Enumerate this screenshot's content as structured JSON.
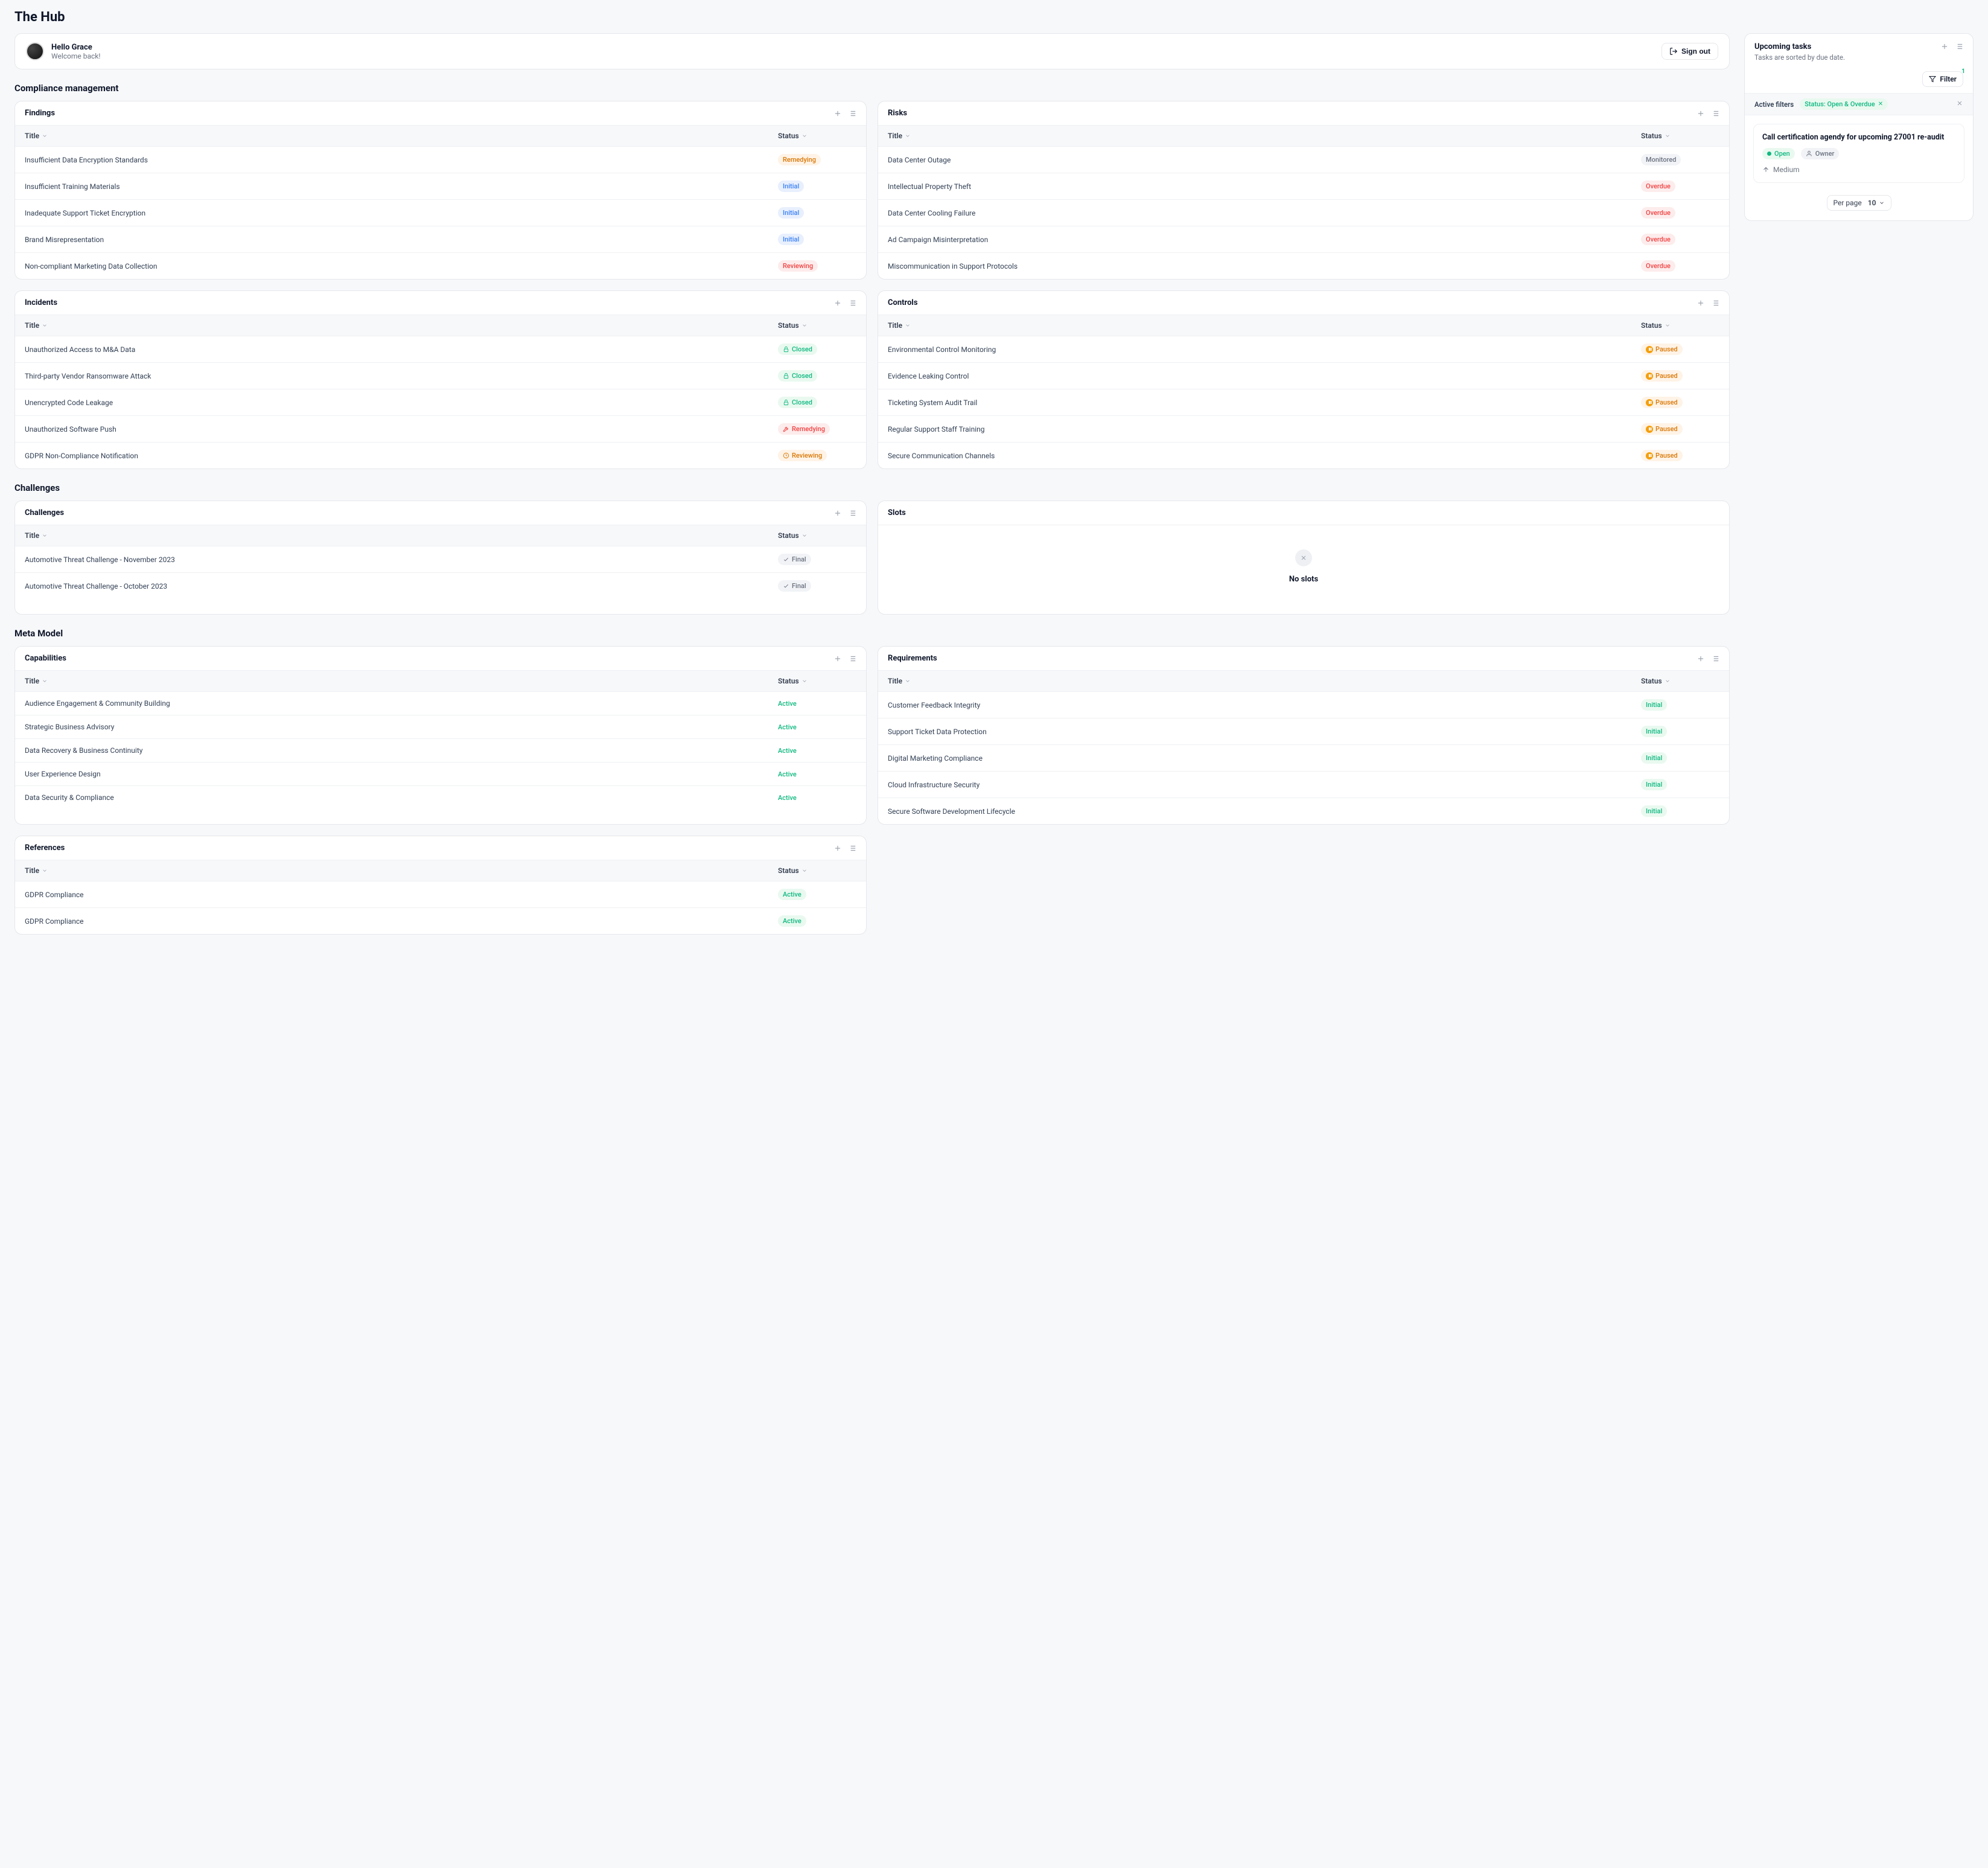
{
  "app_title": "The Hub",
  "hello": {
    "name": "Hello Grace",
    "sub": "Welcome back!",
    "signout": "Sign out"
  },
  "sections": {
    "compliance": "Compliance management",
    "challenges": "Challenges",
    "meta": "Meta Model"
  },
  "cols": {
    "title": "Title",
    "status": "Status"
  },
  "panels": {
    "findings": {
      "title": "Findings",
      "rows": [
        {
          "t": "Insufficient Data Encryption Standards",
          "s": "Remedying",
          "cls": "pill-remedying"
        },
        {
          "t": "Insufficient Training Materials",
          "s": "Initial",
          "cls": "pill-initial"
        },
        {
          "t": "Inadequate Support Ticket Encryption",
          "s": "Initial",
          "cls": "pill-initial"
        },
        {
          "t": "Brand Misrepresentation",
          "s": "Initial",
          "cls": "pill-initial"
        },
        {
          "t": "Non-compliant Marketing Data Collection",
          "s": "Reviewing",
          "cls": "pill-reviewing"
        }
      ]
    },
    "risks": {
      "title": "Risks",
      "rows": [
        {
          "t": "Data Center Outage",
          "s": "Monitored",
          "cls": "pill-monitored"
        },
        {
          "t": "Intellectual Property Theft",
          "s": "Overdue",
          "cls": "pill-overdue"
        },
        {
          "t": "Data Center Cooling Failure",
          "s": "Overdue",
          "cls": "pill-overdue"
        },
        {
          "t": "Ad Campaign Misinterpretation",
          "s": "Overdue",
          "cls": "pill-overdue"
        },
        {
          "t": "Miscommunication in Support Protocols",
          "s": "Overdue",
          "cls": "pill-overdue"
        }
      ]
    },
    "incidents": {
      "title": "Incidents",
      "rows": [
        {
          "t": "Unauthorized Access to M&A Data",
          "s": "Closed",
          "cls": "pill-closed",
          "icon": "lock"
        },
        {
          "t": "Third-party Vendor Ransomware Attack",
          "s": "Closed",
          "cls": "pill-closed",
          "icon": "lock"
        },
        {
          "t": "Unencrypted Code Leakage",
          "s": "Closed",
          "cls": "pill-closed",
          "icon": "lock"
        },
        {
          "t": "Unauthorized Software Push",
          "s": "Remedying",
          "cls": "pill-oremedying",
          "icon": "tools"
        },
        {
          "t": "GDPR Non-Compliance Notification",
          "s": "Reviewing",
          "cls": "pill-oreviewing",
          "icon": "clock"
        }
      ]
    },
    "controls": {
      "title": "Controls",
      "rows": [
        {
          "t": "Environmental Control Monitoring",
          "s": "Paused",
          "cls": "pill-paused",
          "icon": "pause"
        },
        {
          "t": "Evidence Leaking Control",
          "s": "Paused",
          "cls": "pill-paused",
          "icon": "pause"
        },
        {
          "t": "Ticketing System Audit Trail",
          "s": "Paused",
          "cls": "pill-paused",
          "icon": "pause"
        },
        {
          "t": "Regular Support Staff Training",
          "s": "Paused",
          "cls": "pill-paused",
          "icon": "pause"
        },
        {
          "t": "Secure Communication Channels",
          "s": "Paused",
          "cls": "pill-paused",
          "icon": "pause"
        }
      ]
    },
    "challenges": {
      "title": "Challenges",
      "rows": [
        {
          "t": "Automotive Threat Challenge - November 2023",
          "s": "Final",
          "cls": "pill-final",
          "icon": "check"
        },
        {
          "t": "Automotive Threat Challenge - October 2023",
          "s": "Final",
          "cls": "pill-final",
          "icon": "check"
        }
      ]
    },
    "slots": {
      "title": "Slots",
      "empty": "No slots"
    },
    "capabilities": {
      "title": "Capabilities",
      "rows": [
        {
          "t": "Audience Engagement & Community Building",
          "s": "Active",
          "plain": "status-active"
        },
        {
          "t": "Strategic Business Advisory",
          "s": "Active",
          "plain": "status-active"
        },
        {
          "t": "Data Recovery & Business Continuity",
          "s": "Active",
          "plain": "status-active"
        },
        {
          "t": "User Experience Design",
          "s": "Active",
          "plain": "status-active"
        },
        {
          "t": "Data Security & Compliance",
          "s": "Active",
          "plain": "status-active"
        }
      ]
    },
    "requirements": {
      "title": "Requirements",
      "rows": [
        {
          "t": "Customer Feedback Integrity",
          "s": "Initial",
          "cls": "pill-ginitial"
        },
        {
          "t": "Support Ticket Data Protection",
          "s": "Initial",
          "cls": "pill-ginitial"
        },
        {
          "t": "Digital Marketing Compliance",
          "s": "Initial",
          "cls": "pill-ginitial"
        },
        {
          "t": "Cloud Infrastructure Security",
          "s": "Initial",
          "cls": "pill-ginitial"
        },
        {
          "t": "Secure Software Development Lifecycle",
          "s": "Initial",
          "cls": "pill-ginitial"
        }
      ]
    },
    "references": {
      "title": "References",
      "rows": [
        {
          "t": "GDPR Compliance",
          "s": "Active",
          "cls": "pill-active"
        },
        {
          "t": "GDPR Compliance",
          "s": "Active",
          "cls": "pill-active"
        }
      ]
    }
  },
  "tasks": {
    "title": "Upcoming tasks",
    "sub": "Tasks are sorted by due date.",
    "filter_label": "Filter",
    "filter_count": "1",
    "active_filters_label": "Active filters",
    "chip": "Status: Open & Overdue",
    "item": {
      "title": "Call certification agendy for upcoming 27001 re-audit",
      "open": "Open",
      "owner": "Owner",
      "priority": "Medium"
    },
    "per_page": "Per page",
    "per_page_val": "10"
  }
}
